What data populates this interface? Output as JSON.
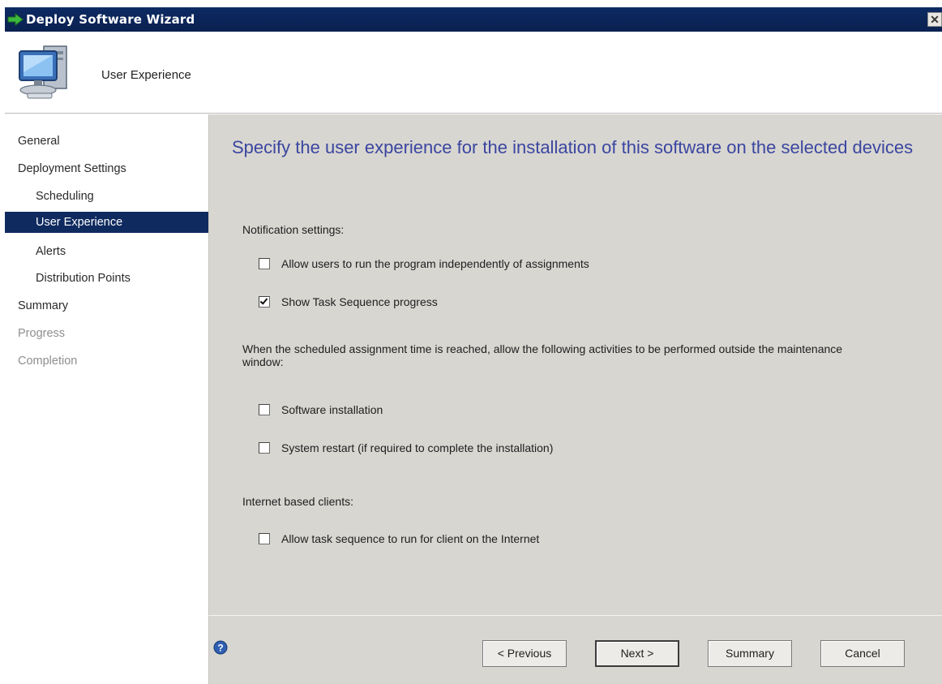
{
  "window": {
    "title": "Deploy Software Wizard",
    "close_label": "✕"
  },
  "header": {
    "title": "User Experience"
  },
  "sidebar": {
    "items": [
      {
        "label": "General",
        "state": "normal"
      },
      {
        "label": "Deployment Settings",
        "state": "normal"
      },
      {
        "label": "Scheduling",
        "state": "normal"
      },
      {
        "label": "User Experience",
        "state": "selected"
      },
      {
        "label": "Alerts",
        "state": "normal"
      },
      {
        "label": "Distribution Points",
        "state": "normal"
      },
      {
        "label": "Summary",
        "state": "normal"
      },
      {
        "label": "Progress",
        "state": "disabled"
      },
      {
        "label": "Completion",
        "state": "disabled"
      }
    ]
  },
  "main": {
    "heading": "Specify the user experience for the installation of this software on the selected devices",
    "notification_label": "Notification settings:",
    "notification_options": [
      {
        "label": "Allow users to run the program independently of assignments",
        "checked": false
      },
      {
        "label": "Show Task Sequence progress",
        "checked": true
      }
    ],
    "maintenance_text": "When the scheduled assignment time is reached, allow the following activities to be performed outside the maintenance window:",
    "maintenance_options": [
      {
        "label": "Software installation",
        "checked": false
      },
      {
        "label": "System restart (if required to complete the installation)",
        "checked": false
      }
    ],
    "internet_label": "Internet based clients:",
    "internet_options": [
      {
        "label": "Allow task sequence to run for client on the Internet",
        "checked": false
      }
    ]
  },
  "footer": {
    "previous_label": "< Previous",
    "next_label": "Next >",
    "summary_label": "Summary",
    "cancel_label": "Cancel"
  }
}
